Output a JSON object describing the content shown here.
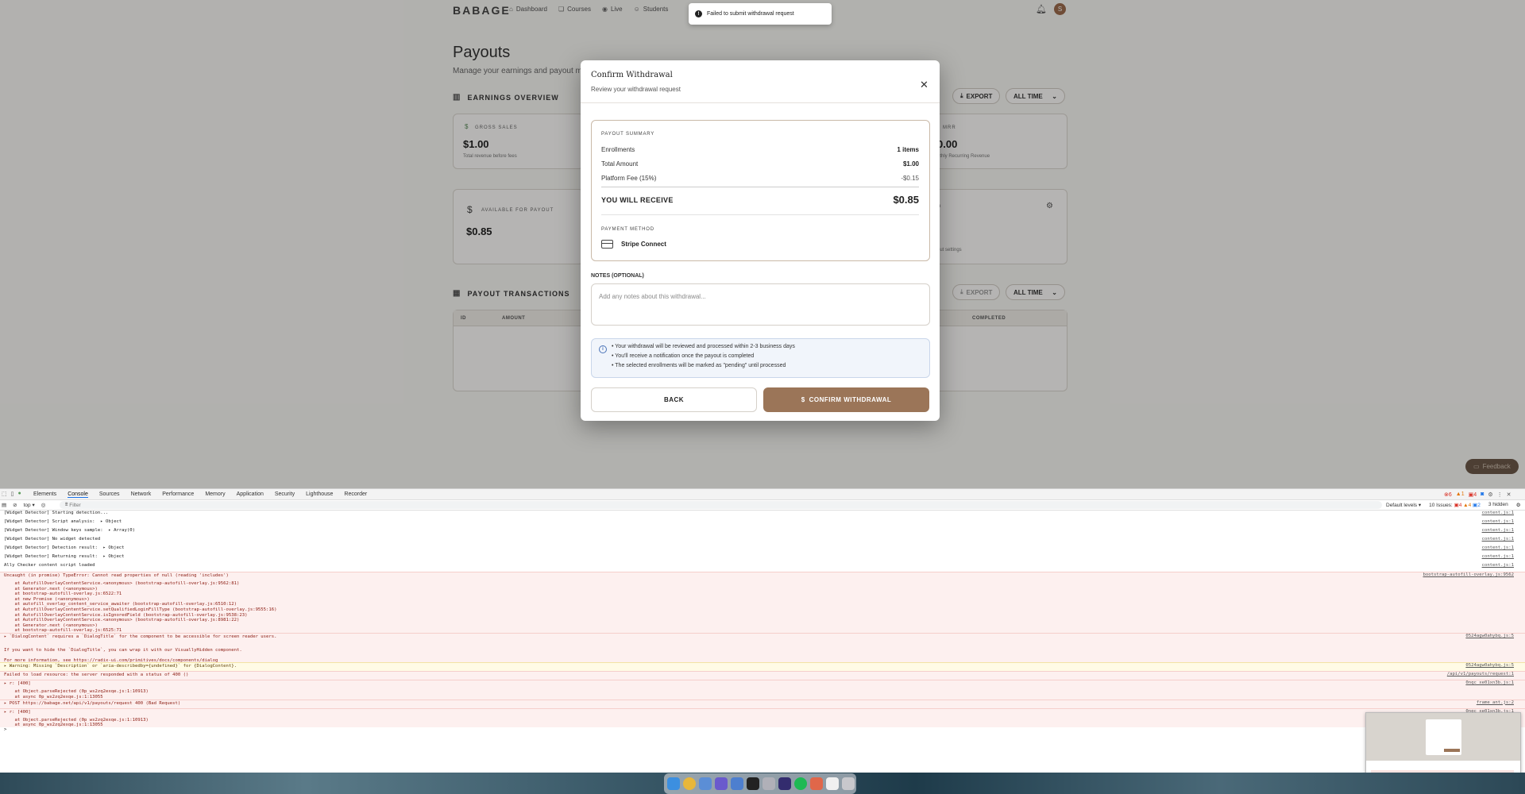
{
  "app": {
    "brand": "BABAGE",
    "nav": [
      {
        "label": "Dashboard",
        "icon": "home-icon"
      },
      {
        "label": "Courses",
        "icon": "book-icon"
      },
      {
        "label": "Live",
        "icon": "broadcast-icon"
      },
      {
        "label": "Students",
        "icon": "users-icon"
      }
    ],
    "avatar_initial": "S",
    "page_title": "Payouts",
    "page_subtitle": "Manage your earnings and payout meth",
    "earnings_title": "EARNINGS OVERVIEW",
    "export_label": "EXPORT",
    "range_label": "ALL TIME",
    "cards": {
      "gross_label": "GROSS SALES",
      "gross_value": "$1.00",
      "gross_note": "Total revenue before fees",
      "mrr_label": "MRR",
      "mrr_value": "0.00",
      "mrr_note": "nthly Recurring Revenue",
      "available_label": "AVAILABLE FOR PAYOUT",
      "available_value": "$0.85",
      "settings_label": "o",
      "settings_note": "out settings"
    },
    "transactions_title": "PAYOUT TRANSACTIONS",
    "table_headers": {
      "id": "ID",
      "amount": "AMOUNT",
      "completed": "COMPLETED"
    },
    "feedback_label": "Feedback"
  },
  "toast": {
    "message": "Failed to submit withdrawal request"
  },
  "modal": {
    "title": "Confirm Withdrawal",
    "subtitle": "Review your withdrawal request",
    "summary_label": "PAYOUT SUMMARY",
    "rows": [
      {
        "label": "Enrollments",
        "value": "1 items"
      },
      {
        "label": "Total Amount",
        "value": "$1.00"
      },
      {
        "label": "Platform Fee (15%)",
        "value": "-$0.15"
      }
    ],
    "receive_label": "YOU WILL RECEIVE",
    "receive_value": "$0.85",
    "payment_method_label": "PAYMENT METHOD",
    "payment_method": "Stripe Connect",
    "notes_label": "NOTES (OPTIONAL)",
    "notes_placeholder": "Add any notes about this withdrawal...",
    "info_lines": [
      "• Your withdrawal will be reviewed and processed within 2-3 business days",
      "• You'll receive a notification once the payout is completed",
      "• The selected enrollments will be marked as \"pending\" until processed"
    ],
    "back_label": "BACK",
    "confirm_label": "CONFIRM WITHDRAWAL"
  },
  "devtools": {
    "tabs": [
      "Elements",
      "Console",
      "Sources",
      "Network",
      "Performance",
      "Memory",
      "Application",
      "Security",
      "Lighthouse",
      "Recorder"
    ],
    "active_tab": "Console",
    "counts": {
      "errors": "6",
      "warnings": "1",
      "messages": "4"
    },
    "context": "top",
    "filter_placeholder": "Filter",
    "levels": "Default levels",
    "issues": "10 Issues:",
    "issue_counts": {
      "errors": "4",
      "warnings": "4",
      "info": "2"
    },
    "hidden": "3 hidden",
    "lines": [
      {
        "text": "[Widget Detector] Starting detection...",
        "src": "content.js:1",
        "kind": "log"
      },
      {
        "text": "[Widget Detector] Script analysis:  ▸ Object",
        "src": "content.js:1",
        "kind": "log"
      },
      {
        "text": "[Widget Detector] Window keys sample:  ▸ Array(0)",
        "src": "content.js:1",
        "kind": "log"
      },
      {
        "text": "[Widget Detector] No widget detected",
        "src": "content.js:1",
        "kind": "log"
      },
      {
        "text": "[Widget Detector] Detection result:  ▸ Object",
        "src": "content.js:1",
        "kind": "log"
      },
      {
        "text": "[Widget Detector] Returning result:  ▸ Object",
        "src": "content.js:1",
        "kind": "log"
      },
      {
        "text": "Ally Checker content script loaded",
        "src": "content.js:1",
        "kind": "log"
      },
      {
        "text": "Uncaught (in promise) TypeError: Cannot read properties of null (reading 'includes')",
        "src": "bootstrap-autofill-overlay.js:9562",
        "kind": "err"
      },
      {
        "text": "    at AutofillOverlayContentService.<anonymous> (bootstrap-autofill-overlay.js:9562:81)",
        "src": "",
        "kind": "errc"
      },
      {
        "text": "    at Generator.next (<anonymous>)",
        "src": "",
        "kind": "errc"
      },
      {
        "text": "    at bootstrap-autofill-overlay.js:6522:71",
        "src": "",
        "kind": "errc"
      },
      {
        "text": "    at new Promise (<anonymous>)",
        "src": "",
        "kind": "errc"
      },
      {
        "text": "    at autofill_overlay_content_service_awaiter (bootstrap-autofill-overlay.js:6510:12)",
        "src": "",
        "kind": "errc"
      },
      {
        "text": "    at AutofillOverlayContentService.setQualifiedLoginFillType (bootstrap-autofill-overlay.js:9555:16)",
        "src": "",
        "kind": "errc"
      },
      {
        "text": "    at AutofillOverlayContentService.isIgnoredField (bootstrap-autofill-overlay.js:9538:23)",
        "src": "",
        "kind": "errc"
      },
      {
        "text": "    at AutofillOverlayContentService.<anonymous> (bootstrap-autofill-overlay.js:8981:22)",
        "src": "",
        "kind": "errc"
      },
      {
        "text": "    at Generator.next (<anonymous>)",
        "src": "",
        "kind": "errc"
      },
      {
        "text": "    at bootstrap-autofill-overlay.js:6525:71",
        "src": "",
        "kind": "errc"
      },
      {
        "text": "▸ `DialogContent` requires a `DialogTitle` for the component to be accessible for screen reader users.",
        "src": "0524agw0ahybq.js:5",
        "kind": "err"
      },
      {
        "text": "",
        "src": "",
        "kind": "errc"
      },
      {
        "text": "If you want to hide the `DialogTitle`, you can wrap it with our VisuallyHidden component.",
        "src": "",
        "kind": "errc"
      },
      {
        "text": "",
        "src": "",
        "kind": "errc"
      },
      {
        "text": "For more information, see https://radix-ui.com/primitives/docs/components/dialog",
        "src": "",
        "kind": "errc"
      },
      {
        "text": "▸ Warning: Missing `Description` or `aria-describedby={undefined}` for {DialogContent}.",
        "src": "0524agw0ahybq.js:5",
        "kind": "warn"
      },
      {
        "text": "Failed to load resource: the server responded with a status of 400 ()",
        "src": "/api/v1/payouts/request:1",
        "kind": "err"
      },
      {
        "text": "▸ r: [400]",
        "src": "0nqc_xe01xn3b.js:1",
        "kind": "err"
      },
      {
        "text": "    at Object.parseRejected (0p_ws2zq2exqe.js:1:10913)",
        "src": "",
        "kind": "errc"
      },
      {
        "text": "    at async 0p_ws2zq2exqe.js:1:13055",
        "src": "",
        "kind": "errc"
      },
      {
        "text": "▸ POST https://babage.net/api/v1/payouts/request 400 (Bad Request)",
        "src": "frame_ant.js:2",
        "kind": "err"
      },
      {
        "text": "▸ r: [400]",
        "src": "0nqc_xe01xn3b.js:1",
        "kind": "err"
      },
      {
        "text": "    at Object.parseRejected (0p_ws2zq2exqe.js:1:10913)",
        "src": "",
        "kind": "errc"
      },
      {
        "text": "    at async 0p_ws2zq2exqe.js:1:13055",
        "src": "",
        "kind": "errc"
      },
      {
        "text": ">",
        "src": "",
        "kind": "log"
      }
    ]
  },
  "colors": {
    "accent": "#9b7558",
    "error_bg": "#fdf0ef",
    "warning_bg": "#fffbe5"
  }
}
